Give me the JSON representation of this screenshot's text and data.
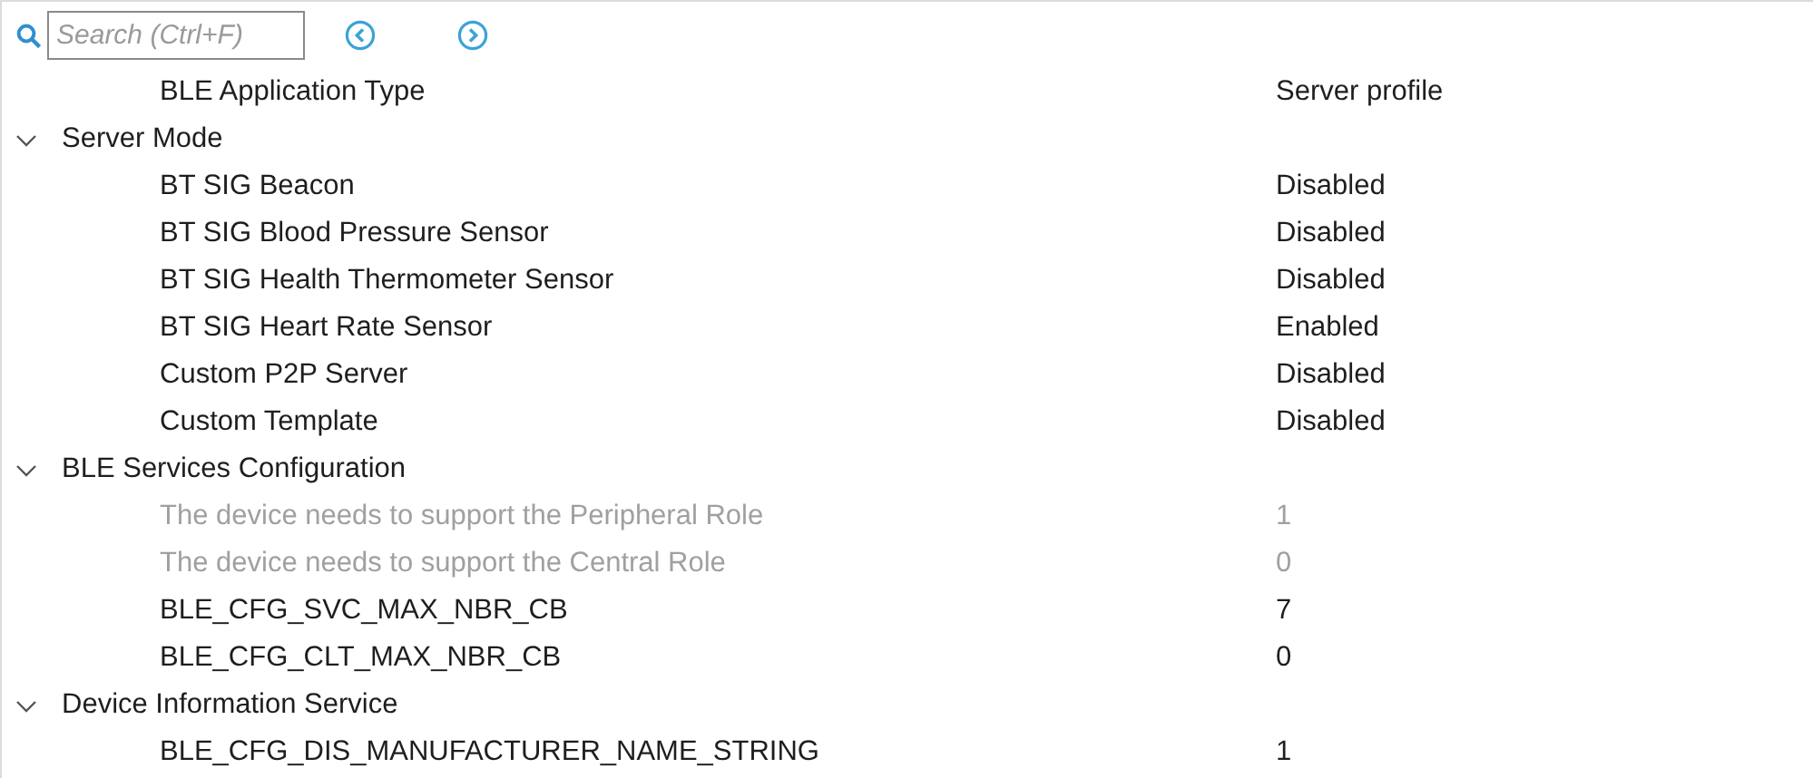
{
  "toolbar": {
    "search": {
      "placeholder": "Search (Ctrl+F)"
    }
  },
  "tree": [
    {
      "kind": "item",
      "label": "BLE Application Type",
      "value": "Server profile",
      "disabled": false
    },
    {
      "kind": "group",
      "label": "Server Mode",
      "expanded": true,
      "children": [
        {
          "kind": "item",
          "label": "BT SIG Beacon",
          "value": "Disabled",
          "disabled": false
        },
        {
          "kind": "item",
          "label": "BT SIG Blood Pressure Sensor",
          "value": "Disabled",
          "disabled": false
        },
        {
          "kind": "item",
          "label": "BT SIG Health Thermometer Sensor",
          "value": "Disabled",
          "disabled": false
        },
        {
          "kind": "item",
          "label": "BT SIG Heart Rate Sensor",
          "value": "Enabled",
          "disabled": false
        },
        {
          "kind": "item",
          "label": "Custom P2P Server",
          "value": "Disabled",
          "disabled": false
        },
        {
          "kind": "item",
          "label": "Custom Template",
          "value": "Disabled",
          "disabled": false
        }
      ]
    },
    {
      "kind": "group",
      "label": "BLE Services Configuration",
      "expanded": true,
      "children": [
        {
          "kind": "item",
          "label": "The device needs to support the Peripheral Role",
          "value": "1",
          "disabled": true
        },
        {
          "kind": "item",
          "label": "The device needs to support the Central Role",
          "value": "0",
          "disabled": true
        },
        {
          "kind": "item",
          "label": "BLE_CFG_SVC_MAX_NBR_CB",
          "value": "7",
          "disabled": false
        },
        {
          "kind": "item",
          "label": "BLE_CFG_CLT_MAX_NBR_CB",
          "value": "0",
          "disabled": false
        }
      ]
    },
    {
      "kind": "group",
      "label": "Device Information Service",
      "expanded": true,
      "children": [
        {
          "kind": "item",
          "label": "BLE_CFG_DIS_MANUFACTURER_NAME_STRING",
          "value": "1",
          "disabled": false
        }
      ]
    }
  ]
}
